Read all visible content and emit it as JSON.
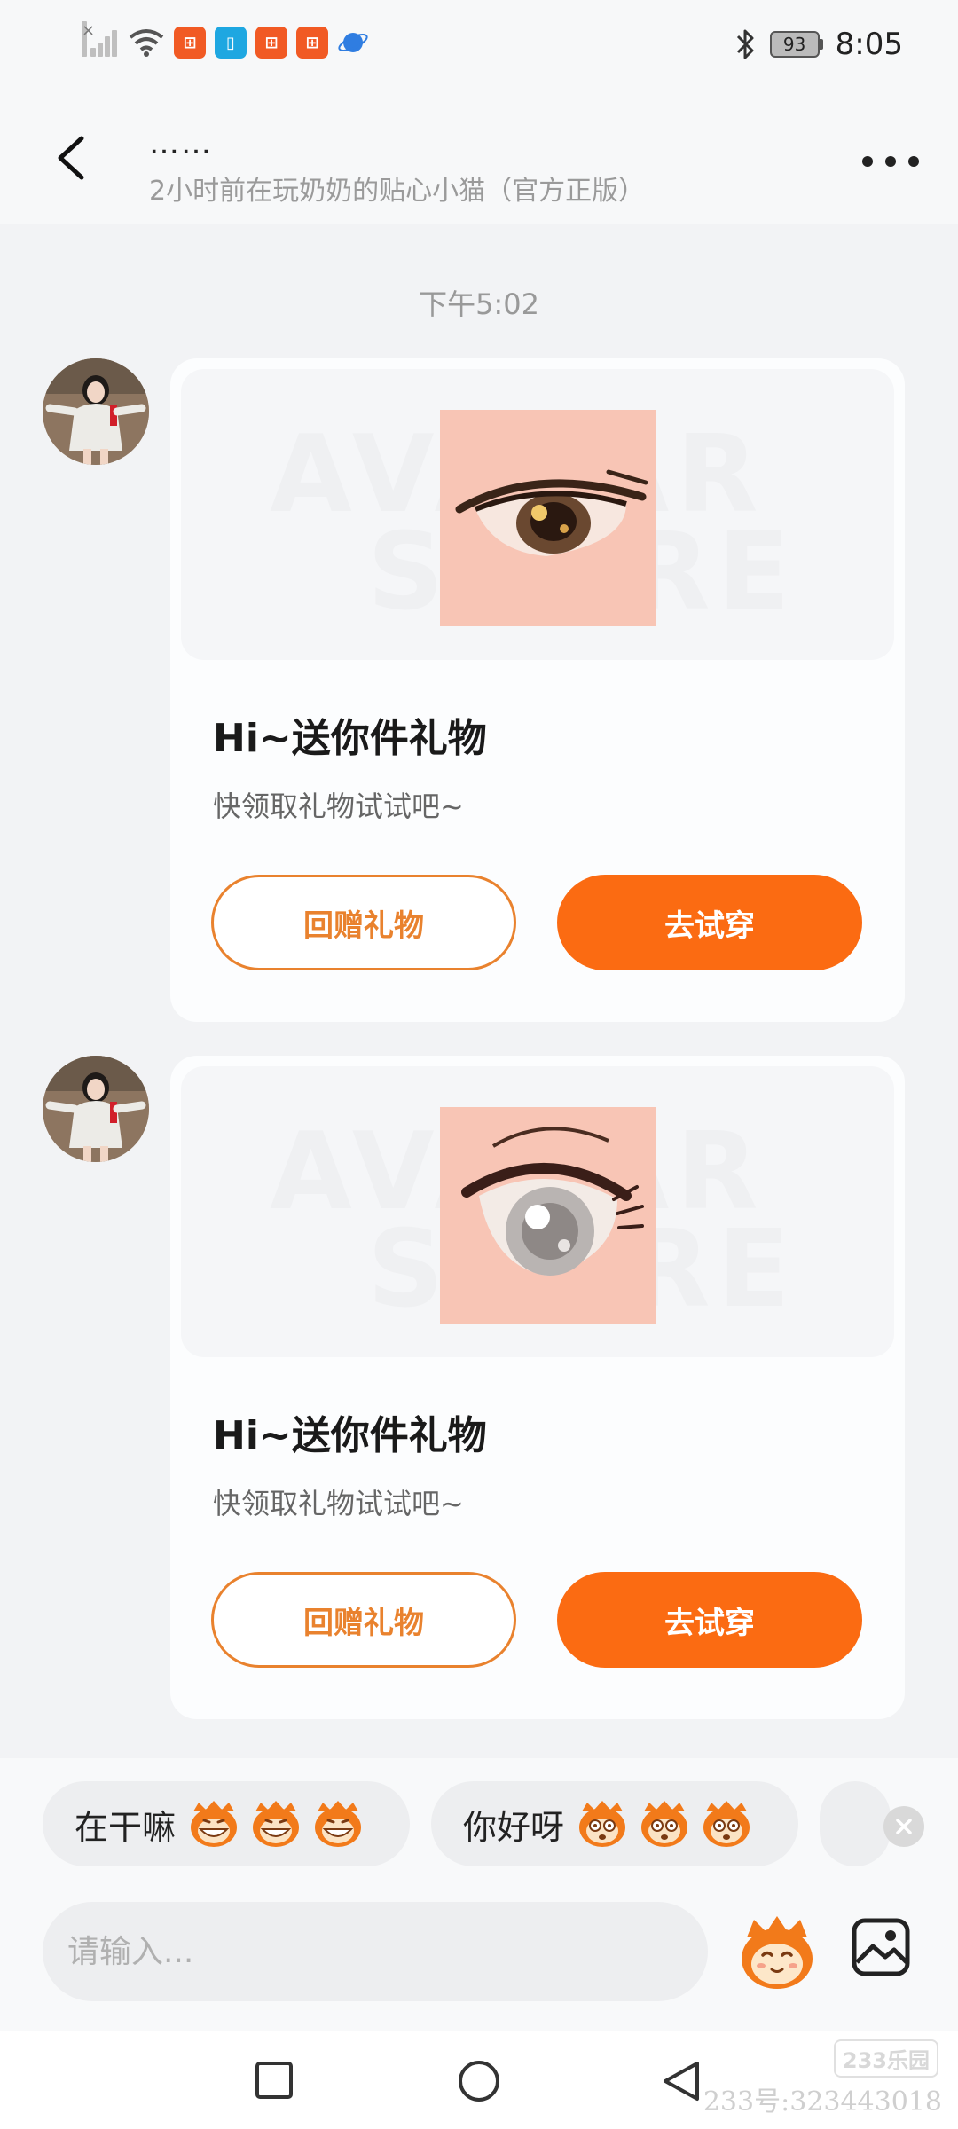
{
  "status_bar": {
    "time": "8:05",
    "battery": "93",
    "app_icons": [
      "app-icon-1",
      "reader-icon",
      "app-icon-2",
      "app-icon-3",
      "browser-icon"
    ]
  },
  "header": {
    "title": "……",
    "subtitle": "2小时前在玩奶奶的贴心小猫（官方正版）"
  },
  "chat": {
    "timestamp": "下午5:02",
    "messages": [
      {
        "title": "Hi~送你件礼物",
        "desc": "快领取礼物试试吧~",
        "return_gift_label": "回赠礼物",
        "try_on_label": "去试穿"
      },
      {
        "title": "Hi~送你件礼物",
        "desc": "快领取礼物试试吧~",
        "return_gift_label": "回赠礼物",
        "try_on_label": "去试穿"
      }
    ]
  },
  "quick_replies": [
    {
      "text": "在干嘛",
      "emoji": "grin-monkey-emoji"
    },
    {
      "text": "你好呀",
      "emoji": "wide-eye-monkey-emoji"
    }
  ],
  "input": {
    "placeholder": "请输入..."
  },
  "watermark": {
    "logo": "233乐园",
    "text": "233号:323443018"
  },
  "colors": {
    "accent": "#fb6b12",
    "accent_outline": "#e9822e"
  }
}
